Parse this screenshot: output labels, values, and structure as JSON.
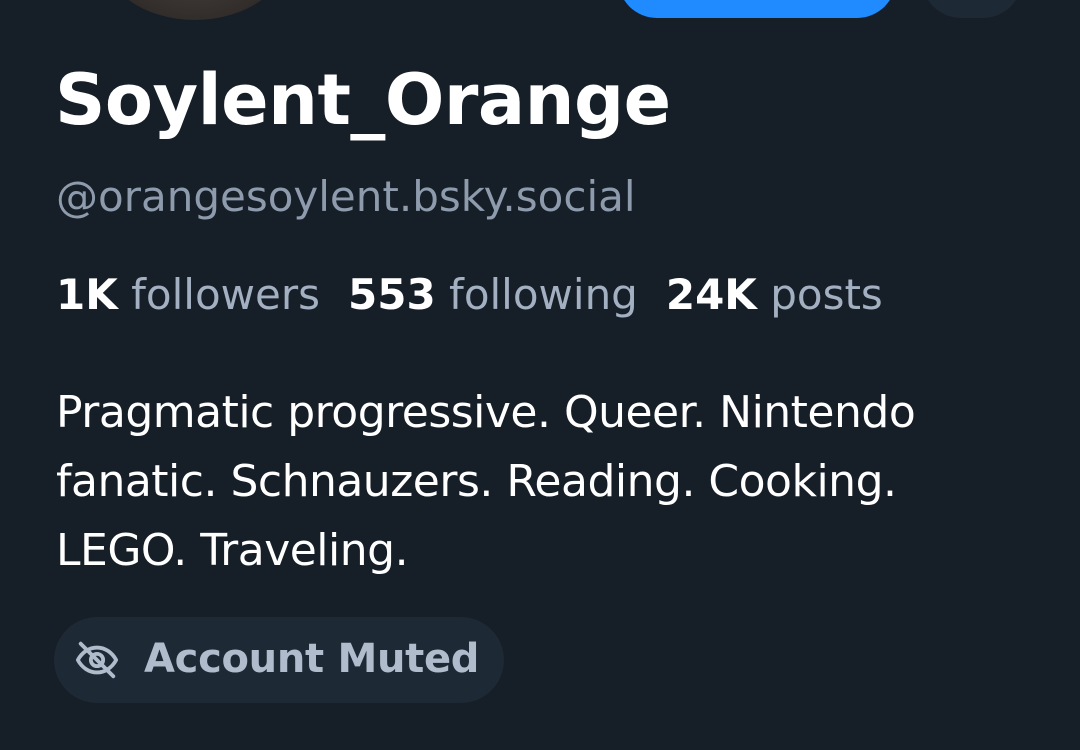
{
  "profile": {
    "display_name": "Soylent_Orange",
    "handle": "@orangesoylent.bsky.social",
    "stats": {
      "followers_count": "1K",
      "followers_label": "followers",
      "following_count": "553",
      "following_label": "following",
      "posts_count": "24K",
      "posts_label": "posts"
    },
    "bio_lines": [
      "Pragmatic progressive. Queer. Nintendo",
      "fanatic. Schnauzers. Reading. Cooking.",
      "LEGO. Traveling."
    ],
    "muted_badge": {
      "icon": "eye-slash-icon",
      "label": "Account Muted"
    }
  },
  "colors": {
    "background": "#161e27",
    "primary_button": "#208bfe",
    "secondary_surface": "#1e2936",
    "muted_text": "#8e9bad"
  }
}
